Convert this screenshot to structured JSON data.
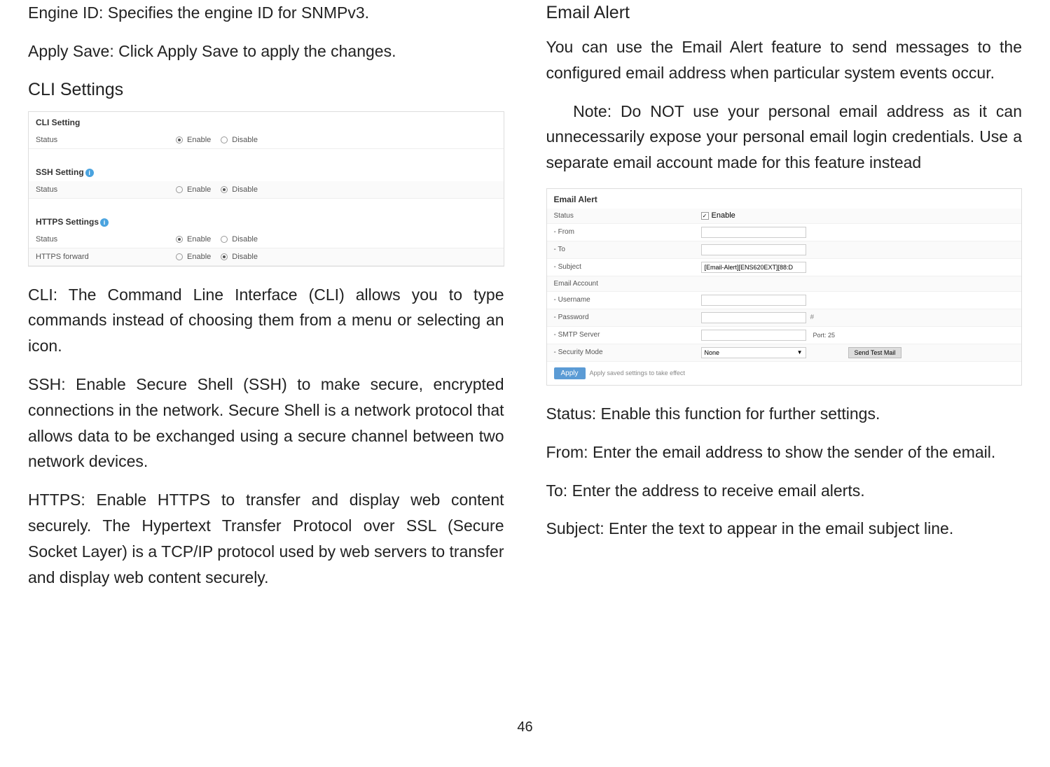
{
  "leftColumn": {
    "paragraphs": [
      "Engine ID: Specifies the engine ID for SNMPv3.",
      "Apply Save: Click Apply Save to apply the changes."
    ],
    "heading": "CLI Settings",
    "cliScreenshot": {
      "sections": [
        {
          "title": "CLI Setting",
          "rows": [
            {
              "label": "Status",
              "enable_selected": true,
              "enable": "Enable",
              "disable": "Disable"
            }
          ]
        },
        {
          "title": "SSH Setting",
          "info": true,
          "rows": [
            {
              "label": "Status",
              "enable_selected": false,
              "enable": "Enable",
              "disable": "Disable"
            }
          ]
        },
        {
          "title": "HTTPS Settings",
          "info": true,
          "rows": [
            {
              "label": "Status",
              "enable_selected": true,
              "enable": "Enable",
              "disable": "Disable"
            },
            {
              "label": "HTTPS forward",
              "enable_selected": false,
              "enable": "Enable",
              "disable": "Disable"
            }
          ]
        }
      ]
    },
    "afterParagraphs": [
      "CLI: The Command Line Interface (CLI) allows you to type commands instead of choosing them from a menu or selecting an icon.",
      "SSH: Enable Secure Shell (SSH) to make secure, encrypted connections in the network. Secure Shell is a network protocol that allows data to be exchanged using a secure channel between two network devices.",
      "HTTPS: Enable HTTPS to transfer and display web content securely. The Hypertext Transfer Protocol over SSL (Secure Socket Layer) is a TCP/IP protocol used by web servers to transfer and display web content securely."
    ]
  },
  "rightColumn": {
    "heading": "Email Alert",
    "introParagraphs": [
      "You can use the Email Alert feature to send messages to the configured email address when particular system events occur.",
      "   Note: Do NOT use your personal email address as it can unnecessarily expose your personal email login credentials. Use a separate email account made for this feature instead"
    ],
    "emailScreenshot": {
      "title": "Email Alert",
      "statusLabel": "Status",
      "enable": "Enable",
      "checked": true,
      "rows": {
        "from": "- From",
        "to": "- To",
        "subject": "- Subject",
        "subjectValue": "[Email-Alert][ENS620EXT][88:D",
        "emailAccount": "Email Account",
        "username": "- Username",
        "password": "- Password",
        "smtp": "- SMTP Server",
        "port": "Port: 25",
        "security": "- Security Mode",
        "securityValue": "None",
        "sendTest": "Send Test Mail"
      },
      "applyBtn": "Apply",
      "applyNote": "Apply saved settings to take effect"
    },
    "afterParagraphs": [
      "Status: Enable this function for further settings.",
      "From: Enter the email address to show the sender of the email.",
      "To: Enter the address to receive email alerts.",
      "Subject: Enter the text to appear in the email subject line."
    ]
  },
  "pageNumber": "46"
}
